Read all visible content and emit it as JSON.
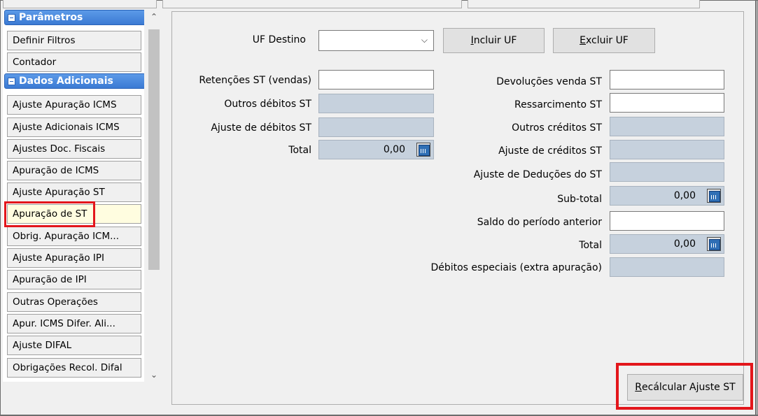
{
  "sidebar": {
    "groups": [
      {
        "label": "Parâmetros"
      },
      {
        "label": "Dados Adicionais"
      }
    ],
    "items": [
      {
        "label": "Definir Filtros"
      },
      {
        "label": "Contador"
      },
      {
        "label": "Ajuste Apuração ICMS"
      },
      {
        "label": "Ajuste Adicionais ICMS"
      },
      {
        "label": "Ajustes Doc. Fiscais"
      },
      {
        "label": "Apuração de ICMS"
      },
      {
        "label": "Ajuste Apuração ST"
      },
      {
        "label": "Apuração de ST"
      },
      {
        "label": "Obrig. Apuração ICM..."
      },
      {
        "label": "Ajuste Apuração IPI"
      },
      {
        "label": "Apuração de IPI"
      },
      {
        "label": "Outras Operações"
      },
      {
        "label": "Apur. ICMS Difer. Ali..."
      },
      {
        "label": "Ajuste DIFAL"
      },
      {
        "label": "Obrigações Recol. Difal"
      }
    ],
    "selected": "Apuração de ST"
  },
  "form": {
    "uf_destino_label": "UF Destino",
    "uf_destino_value": "",
    "incluir_uf_hotkey": "I",
    "incluir_uf_rest": "ncluir UF",
    "excluir_uf_hotkey": "E",
    "excluir_uf_rest": "xcluir UF",
    "left": {
      "retencoes_label": "Retenções ST (vendas)",
      "outros_debitos_label": "Outros débitos ST",
      "ajuste_debitos_label": "Ajuste de débitos ST",
      "total_label": "Total",
      "total_value": "0,00"
    },
    "right": {
      "devolucoes_label": "Devoluções venda ST",
      "ressarcimento_label": "Ressarcimento ST",
      "outros_creditos_label": "Outros créditos ST",
      "ajuste_creditos_label": "Ajuste de créditos ST",
      "ajuste_deducoes_label": "Ajuste de  Deduções do ST",
      "subtotal_label": "Sub-total",
      "subtotal_value": "0,00",
      "saldo_anterior_label": "Saldo do período anterior",
      "total_label": "Total",
      "total_value": "0,00",
      "debitos_especiais_label": "Débitos especiais (extra apuração)"
    },
    "recalc_hotkey": "R",
    "recalc_rest": "ecálcular Ajuste ST"
  },
  "icons": [
    "collapse-minus-icon",
    "scroll-up-icon",
    "scroll-down-icon",
    "chevron-down-icon",
    "calculator-icon"
  ],
  "colors": {
    "group_header": "#3b7ad4",
    "readonly_field": "#c6d1dd",
    "highlight": "#e3161b",
    "selected_item": "#fffde0"
  }
}
